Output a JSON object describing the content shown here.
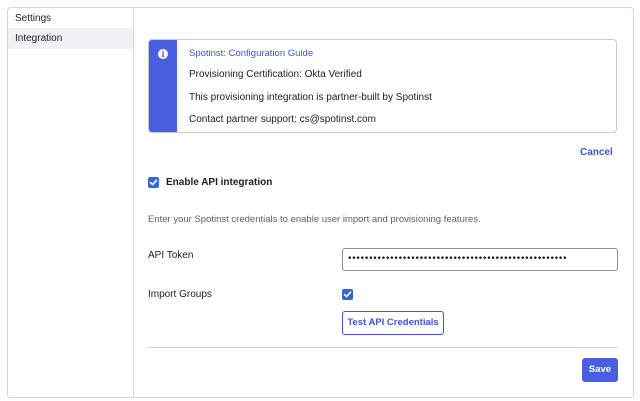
{
  "sidebar": {
    "title": "Settings",
    "items": [
      {
        "label": "Integration",
        "selected": true
      }
    ]
  },
  "callout": {
    "icon": "info-icon",
    "link": "Spotinst: Configuration Guide",
    "lines": [
      "Provisioning Certification: Okta Verified",
      "This provisioning integration is partner-built by Spotinst",
      "Contact partner support: cs@spotinst.com"
    ]
  },
  "actions": {
    "cancel": "Cancel",
    "save": "Save"
  },
  "enable_api": {
    "label": "Enable API integration",
    "checked": true
  },
  "helper_text": "Enter your Spotinst credentials to enable user import and provisioning features.",
  "form": {
    "api_token": {
      "label": "API Token",
      "value": "••••••••••••••••••••••••••••••••••••••••••••••••••••"
    },
    "import_groups": {
      "label": "Import Groups",
      "checked": true
    },
    "test_button": "Test API Credentials"
  },
  "colors": {
    "accent": "#4a5fe0",
    "link": "#3e55d8",
    "checkbox": "#3567d6"
  }
}
